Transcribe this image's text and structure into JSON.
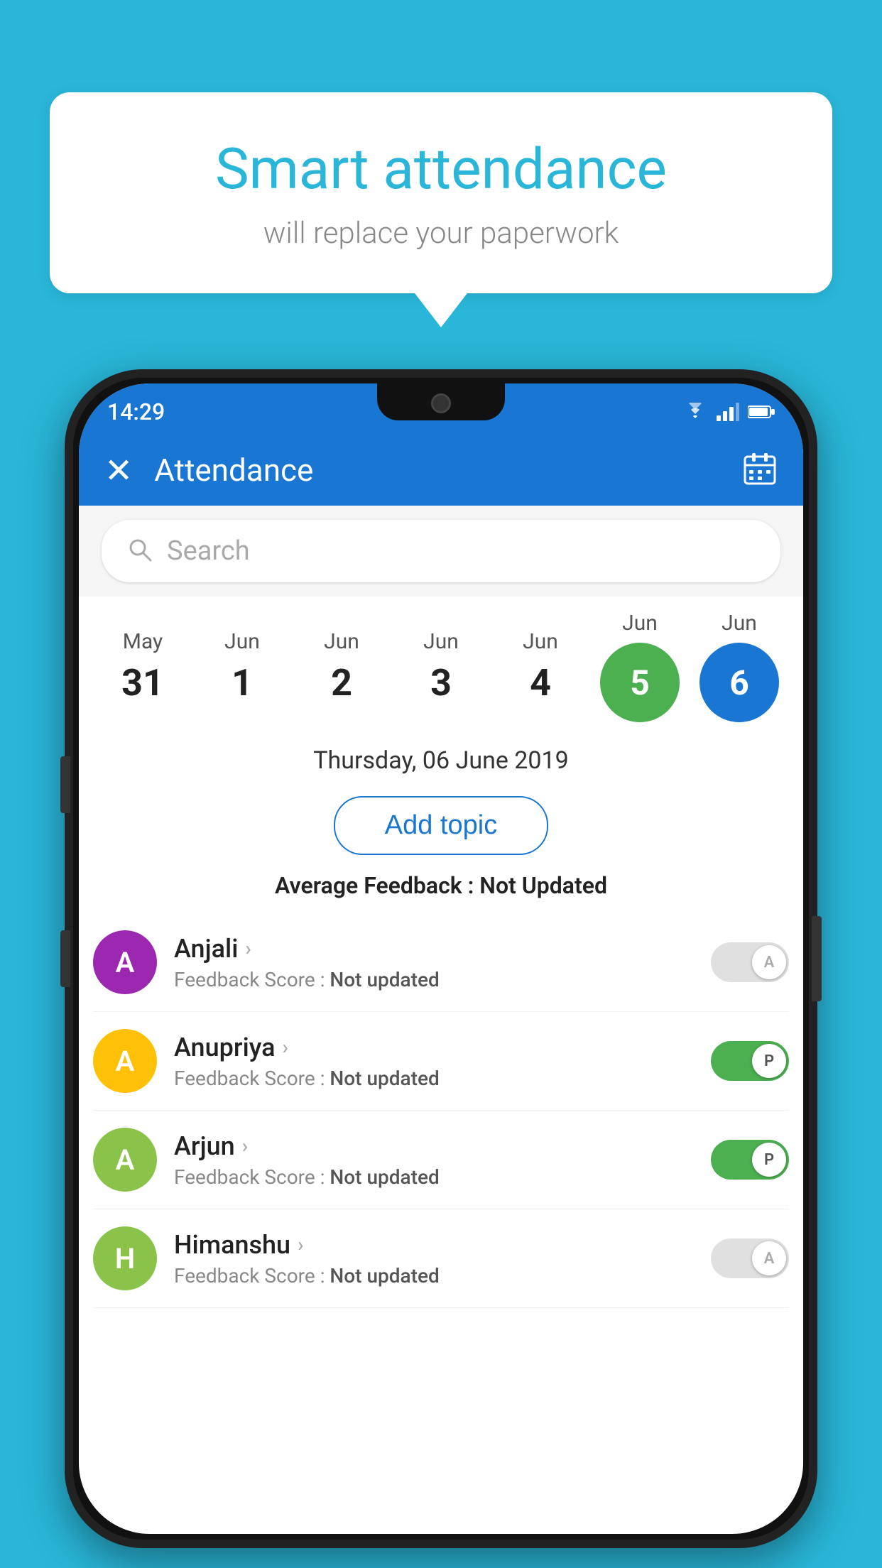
{
  "background_color": "#29b6d8",
  "bubble": {
    "title": "Smart attendance",
    "subtitle": "will replace your paperwork"
  },
  "status_bar": {
    "time": "14:29",
    "icons": [
      "wifi",
      "signal",
      "battery"
    ]
  },
  "app_bar": {
    "title": "Attendance",
    "close_label": "✕",
    "calendar_icon": "📅"
  },
  "search": {
    "placeholder": "Search"
  },
  "dates": [
    {
      "month": "May",
      "day": "31",
      "highlighted": false
    },
    {
      "month": "Jun",
      "day": "1",
      "highlighted": false
    },
    {
      "month": "Jun",
      "day": "2",
      "highlighted": false
    },
    {
      "month": "Jun",
      "day": "3",
      "highlighted": false
    },
    {
      "month": "Jun",
      "day": "4",
      "highlighted": false
    },
    {
      "month": "Jun",
      "day": "5",
      "highlighted": "green"
    },
    {
      "month": "Jun",
      "day": "6",
      "highlighted": "blue"
    }
  ],
  "selected_date": "Thursday, 06 June 2019",
  "add_topic_label": "Add topic",
  "avg_feedback_label": "Average Feedback :",
  "avg_feedback_value": "Not Updated",
  "students": [
    {
      "name": "Anjali",
      "avatar_letter": "A",
      "avatar_color": "#9c27b0",
      "feedback_label": "Feedback Score :",
      "feedback_value": "Not updated",
      "attendance": "off",
      "toggle_letter": "A"
    },
    {
      "name": "Anupriya",
      "avatar_letter": "A",
      "avatar_color": "#ffc107",
      "feedback_label": "Feedback Score :",
      "feedback_value": "Not updated",
      "attendance": "on",
      "toggle_letter": "P"
    },
    {
      "name": "Arjun",
      "avatar_letter": "A",
      "avatar_color": "#8bc34a",
      "feedback_label": "Feedback Score :",
      "feedback_value": "Not updated",
      "attendance": "on",
      "toggle_letter": "P"
    },
    {
      "name": "Himanshu",
      "avatar_letter": "H",
      "avatar_color": "#8bc34a",
      "feedback_label": "Feedback Score :",
      "feedback_value": "Not updated",
      "attendance": "off",
      "toggle_letter": "A"
    }
  ]
}
